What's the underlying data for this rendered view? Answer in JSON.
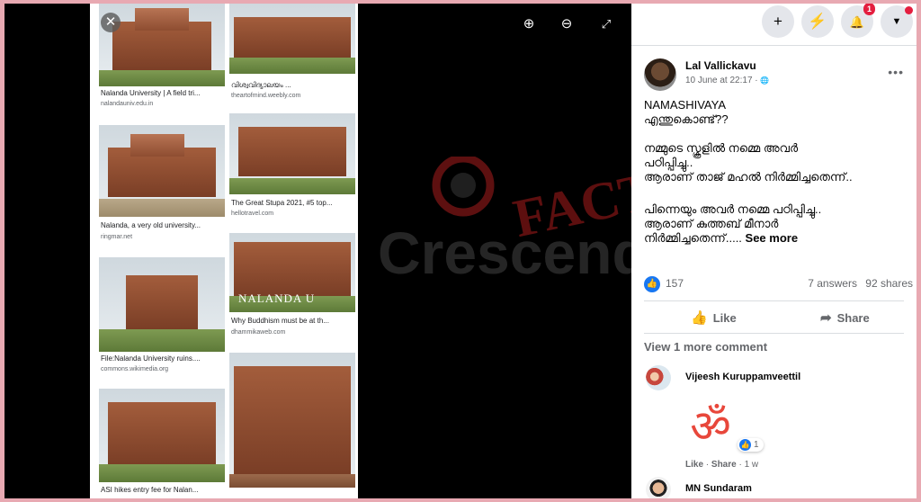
{
  "viewer": {
    "close_icon": "✕",
    "zoom_in_icon": "⊕",
    "zoom_out_icon": "⊖",
    "fullscreen_icon": "⤢",
    "results": [
      {
        "caption": "Nalanda University | A field tri...",
        "source": "nalandauniv.edu.in"
      },
      {
        "caption": "വിശ്വവിദ്യാലയം ...",
        "source": "theartofmind.weebly.com"
      },
      {
        "caption": "Nalanda, a very old university...",
        "source": "ringmar.net"
      },
      {
        "caption": "The Great Stupa 2021, #5 top...",
        "source": "hellotravel.com"
      },
      {
        "caption": "File:Nalanda University ruins....",
        "source": "commons.wikimedia.org"
      },
      {
        "caption": "Why Buddhism must be at th...",
        "source": "dhammikaweb.com"
      },
      {
        "caption": "ASI hikes entry fee for Nalan...",
        "source": ""
      }
    ],
    "image_overlay_text": "NALANDA U"
  },
  "watermark": {
    "word1": "FACT",
    "word2": "Crescendo"
  },
  "topbar": {
    "plus_icon": "+",
    "messenger_icon": "⚡",
    "bell_icon": "🔔",
    "bell_badge": "1",
    "caret_icon": "▼"
  },
  "post": {
    "author": "Lal Vallickavu",
    "date": "10 June at 22:17 · ",
    "globe_icon": "🌐",
    "more_icon": "•••",
    "lines": [
      "NAMASHIVAYA",
      "എന്തുകൊണ്ട്??",
      "നമ്മുടെ സ്കൂളിൽ നമ്മെ അവർ",
      "പഠിപ്പിച്ചു..",
      "ആരാണ് താജ് മഹൽ നിർമ്മിച്ചതെന്ന്..",
      "പിന്നെയും അവർ നമ്മെ പഠിപ്പിച്ചു..",
      "ആരാണ് കുത്തബ് മീനാർ",
      "നിർമ്മിച്ചതെന്ന്..... "
    ],
    "see_more": "See more",
    "reaction_icon": "👍",
    "reaction_count": "157",
    "answers": "7 answers",
    "shares": "92 shares",
    "like_label": "Like",
    "like_icon": "👍",
    "share_label": "Share",
    "share_icon": "➦",
    "view_more_comment": "View 1 more comment"
  },
  "comments": [
    {
      "name": "Vijeesh Kuruppamveettil",
      "sticker": "ॐ",
      "reaction_count": "1",
      "like": "Like",
      "share": "Share",
      "time": "1 w"
    },
    {
      "name": "MN Sundaram"
    }
  ]
}
